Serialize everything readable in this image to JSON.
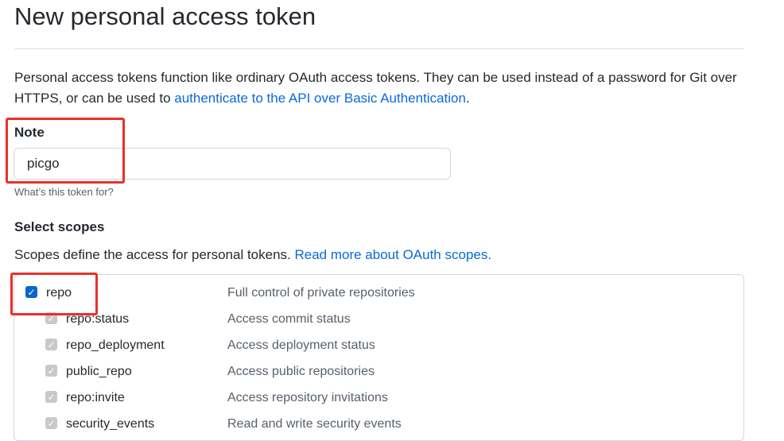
{
  "header": {
    "title": "New personal access token"
  },
  "intro": {
    "text": "Personal access tokens function like ordinary OAuth access tokens. They can be used instead of a password for Git over HTTPS, or can be used to ",
    "link": "authenticate to the API over Basic Authentication",
    "suffix": "."
  },
  "note": {
    "label": "Note",
    "value": "picgo",
    "hint": "What’s this token for?"
  },
  "scopes": {
    "heading": "Select scopes",
    "description": "Scopes define the access for personal tokens. ",
    "link": "Read more about OAuth scopes.",
    "items": [
      {
        "name": "repo",
        "description": "Full control of private repositories",
        "checked": true,
        "disabled": false
      },
      {
        "name": "repo:status",
        "description": "Access commit status",
        "checked": true,
        "disabled": true
      },
      {
        "name": "repo_deployment",
        "description": "Access deployment status",
        "checked": true,
        "disabled": true
      },
      {
        "name": "public_repo",
        "description": "Access public repositories",
        "checked": true,
        "disabled": true
      },
      {
        "name": "repo:invite",
        "description": "Access repository invitations",
        "checked": true,
        "disabled": true
      },
      {
        "name": "security_events",
        "description": "Read and write security events",
        "checked": true,
        "disabled": true
      }
    ]
  },
  "colors": {
    "link": "#0969da",
    "checkbox": "#0b67d0",
    "annotation": "#e8302a"
  }
}
